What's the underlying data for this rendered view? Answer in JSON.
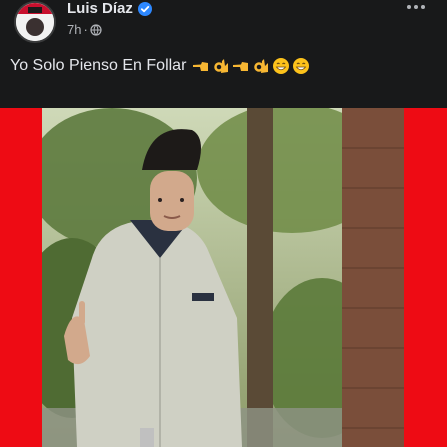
{
  "post": {
    "author": "Luis Díaz",
    "time": "7h",
    "separator": "·",
    "text": "Yo Solo Pienso En Follar",
    "emojis": [
      "backhand-index-pointing-left",
      "ok-hand",
      "backhand-index-pointing-left",
      "ok-hand",
      "grinning-face",
      "grinning-face"
    ]
  },
  "icons": {
    "verified": "verified-badge-icon",
    "privacy": "globe-icon",
    "more": "more-options-icon"
  },
  "colors": {
    "background": "#18191a",
    "text": "#e4e6eb",
    "muted": "#b0b3b8",
    "verified": "#2d88ff",
    "frame": "#ee0b14"
  }
}
